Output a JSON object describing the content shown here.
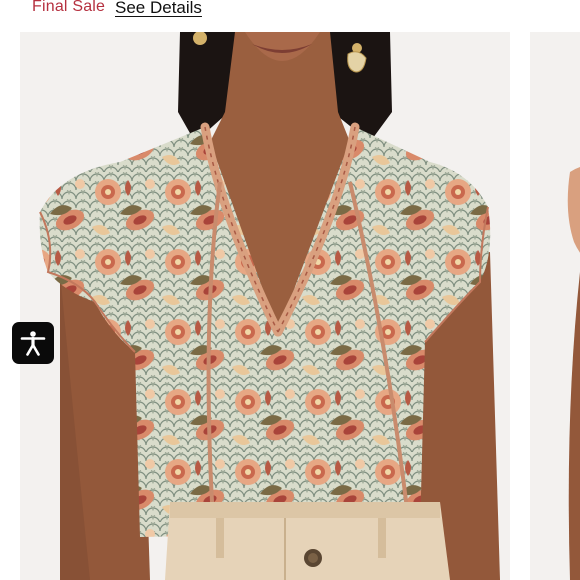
{
  "listing": {
    "final_sale_label": "Final Sale",
    "see_details_label": "See Details"
  },
  "product_image": {
    "icon": "product-photo-floral-ruffle-blouse"
  },
  "accessibility": {
    "icon": "accessibility-icon",
    "background": "#0a0a0a"
  },
  "colors": {
    "final_sale": "#b5303f",
    "link": "#111111",
    "photo_background": "#f3f1ef"
  }
}
